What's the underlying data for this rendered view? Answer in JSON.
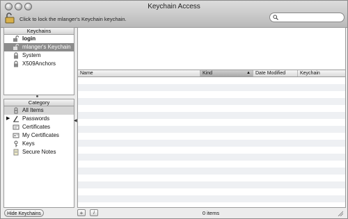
{
  "window": {
    "title": "Keychain Access"
  },
  "toolbar": {
    "lock_message": "Click to lock the mlanger's Keychain keychain.",
    "search": {
      "value": "",
      "placeholder": ""
    }
  },
  "keychains": {
    "header": "Keychains",
    "items": [
      {
        "label": "login",
        "icon": "lock-open-icon",
        "bold": true
      },
      {
        "label": "mlanger's Keychain",
        "icon": "lock-open-icon",
        "selected": true
      },
      {
        "label": "System",
        "icon": "lock-icon"
      },
      {
        "label": "X509Anchors",
        "icon": "lock-icon"
      }
    ]
  },
  "category": {
    "header": "Category",
    "items": [
      {
        "label": "All Items",
        "icon": "all-items-icon",
        "selected": true
      },
      {
        "label": "Passwords",
        "icon": "key-pen-icon",
        "disclosure": true
      },
      {
        "label": "Certificates",
        "icon": "certificate-icon"
      },
      {
        "label": "My Certificates",
        "icon": "my-certificate-icon"
      },
      {
        "label": "Keys",
        "icon": "key-icon"
      },
      {
        "label": "Secure Notes",
        "icon": "note-icon"
      }
    ]
  },
  "table": {
    "columns": [
      "Name",
      "Kind",
      "Date Modified",
      "Keychain"
    ],
    "sorted_column": "Kind"
  },
  "footer": {
    "hide_label": "Hide Keychains",
    "add_label": "+",
    "info_label": "i",
    "count": "0 items"
  }
}
